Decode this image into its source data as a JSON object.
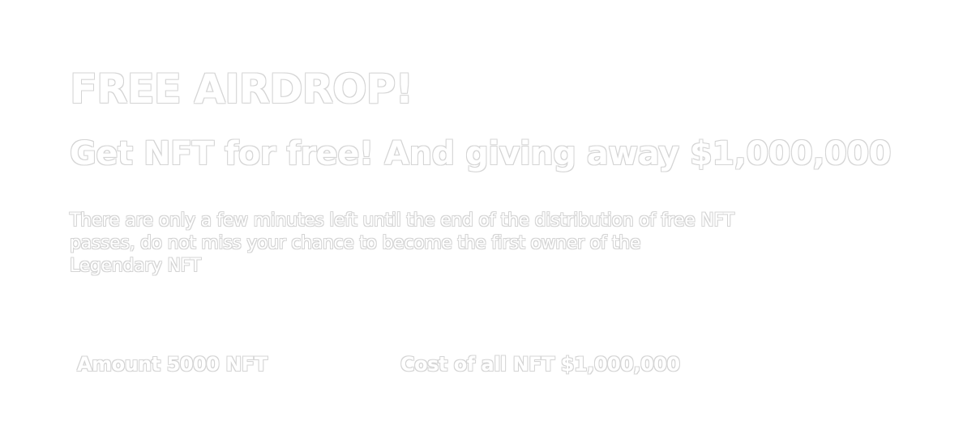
{
  "hero": {
    "title": "FREE AIRDROP!",
    "subtitle": "Get NFT for free! And giving away $1,000,000",
    "description": "There are only a few minutes left until the end of the distribution of free NFT passes, do not miss your chance to become the first owner of the Legendary NFT"
  },
  "stats": {
    "amount": "Amount 5000 NFT",
    "cost": "Cost of all NFT $1,000,000"
  }
}
